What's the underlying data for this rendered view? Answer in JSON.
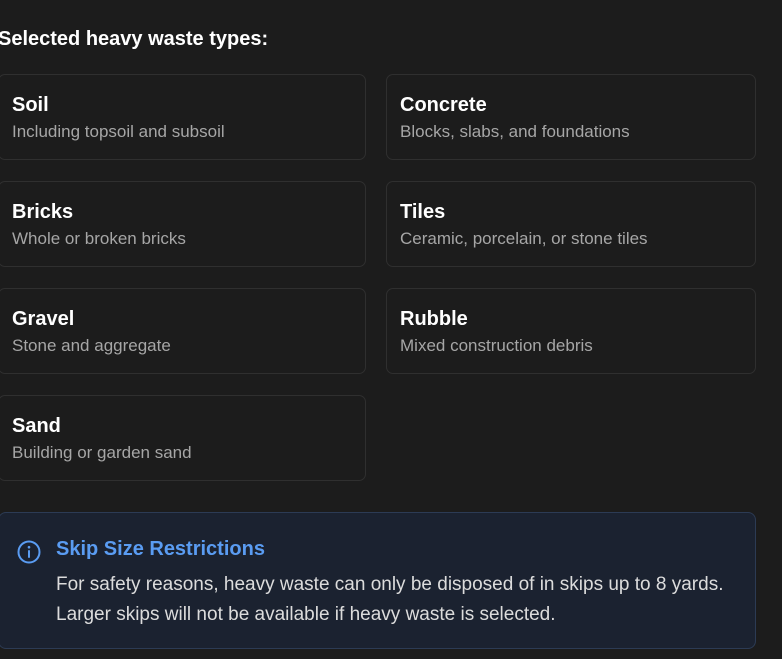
{
  "heading": "Selected heavy waste types:",
  "waste_types": [
    {
      "title": "Soil",
      "description": "Including topsoil and subsoil"
    },
    {
      "title": "Concrete",
      "description": "Blocks, slabs, and foundations"
    },
    {
      "title": "Bricks",
      "description": "Whole or broken bricks"
    },
    {
      "title": "Tiles",
      "description": "Ceramic, porcelain, or stone tiles"
    },
    {
      "title": "Gravel",
      "description": "Stone and aggregate"
    },
    {
      "title": "Rubble",
      "description": "Mixed construction debris"
    },
    {
      "title": "Sand",
      "description": "Building or garden sand"
    }
  ],
  "notice": {
    "icon": "info-icon",
    "title": "Skip Size Restrictions",
    "text": "For safety reasons, heavy waste can only be disposed of in skips up to 8 yards. Larger skips will not be available if heavy waste is selected."
  },
  "colors": {
    "background": "#1c1c1c",
    "card_border": "#2f2f2f",
    "notice_background": "#1b2230",
    "notice_border": "#2c3b54",
    "accent_blue": "#5a9cf2",
    "muted_text": "#a6a6a6"
  }
}
